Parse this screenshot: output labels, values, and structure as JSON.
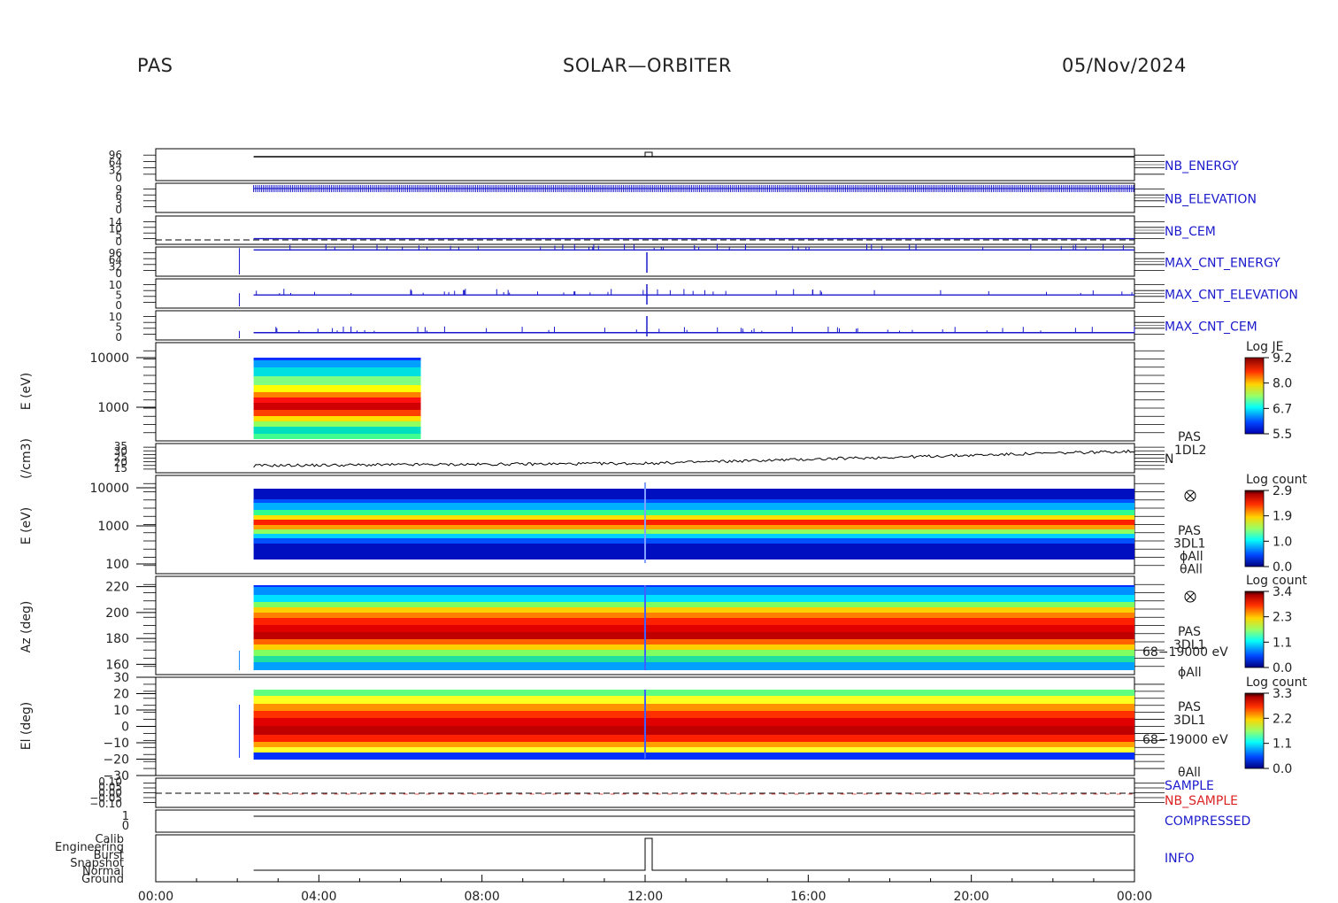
{
  "header": {
    "left": "PAS",
    "center": "SOLAR—ORBITER",
    "right": "05/Nov/2024"
  },
  "chart_data": {
    "type": "timeseries-stack",
    "x": {
      "range": [
        "00:00",
        "24:00"
      ],
      "ticks": [
        "00:00",
        "04:00",
        "08:00",
        "12:00",
        "16:00",
        "20:00",
        "00:00"
      ],
      "data_start_hour": 2.4,
      "spectro1_end_hour": 6.5
    },
    "panels": [
      {
        "id": "nb-energy",
        "label": "NB_ENERGY",
        "label_color": "#1a1acc",
        "yticks": [
          "96",
          "64",
          "32",
          "0"
        ],
        "line_level": 0.75
      },
      {
        "id": "nb-elevation",
        "label": "NB_ELEVATION",
        "label_color": "#1a1acc",
        "yticks": [
          "9",
          "6",
          "3",
          "0"
        ],
        "line_level": 0.82
      },
      {
        "id": "nb-cem",
        "label": "NB_CEM",
        "label_color": "#1a1acc",
        "yticks": [
          "14",
          "10",
          "5",
          "0"
        ],
        "line_level": 0.2
      },
      {
        "id": "max-cnt-energy",
        "label": "MAX_CNT_ENERGY",
        "label_color": "#1a1acc",
        "yticks": [
          "96",
          "64",
          "32",
          "0"
        ],
        "line_level": 0.9
      },
      {
        "id": "max-cnt-elevation",
        "label": "MAX_CNT_ELEVATION",
        "label_color": "#1a1acc",
        "yticks": [
          "10",
          "5",
          "0"
        ],
        "line_level": 0.45
      },
      {
        "id": "max-cnt-cem",
        "label": "MAX_CNT_CEM",
        "label_color": "#1a1acc",
        "yticks": [
          "10",
          "5",
          "0"
        ],
        "line_level": 0.25
      }
    ],
    "spectrograms": [
      {
        "id": "energy-1dl2",
        "ylabel": "E (eV)",
        "scale": "log",
        "yticks": [
          "10000",
          "1000"
        ],
        "peak_eV": 850,
        "colorbar_title": "Log JE",
        "colorbar_ticks": [
          "9.2",
          "8.0",
          "6.7",
          "5.5"
        ]
      },
      {
        "id": "energy-3dl1",
        "ylabel": "E (eV)",
        "scale": "log",
        "yticks": [
          "10000",
          "1000",
          "100"
        ],
        "peak_eV": 800,
        "side_labels": [
          "PAS",
          "3DL1",
          "ϕAll",
          "θAll"
        ],
        "colorbar_title": "Log count",
        "colorbar_ticks": [
          "2.9",
          "1.9",
          "1.0",
          "0.0"
        ]
      },
      {
        "id": "azimuth",
        "ylabel": "Az (deg)",
        "range": [
          152,
          228
        ],
        "yticks": [
          "220",
          "200",
          "180",
          "160"
        ],
        "side_labels": [
          "PAS",
          "3DL1",
          "68−19000 eV",
          "ϕAll"
        ],
        "colorbar_title": "Log count",
        "colorbar_ticks": [
          "3.4",
          "2.3",
          "1.1",
          "0.0"
        ]
      },
      {
        "id": "elevation",
        "ylabel": "El (deg)",
        "range": [
          -30,
          30
        ],
        "yticks": [
          "30",
          "20",
          "10",
          "0",
          "−10",
          "−20",
          "−30"
        ],
        "side_labels": [
          "PAS",
          "3DL1",
          "68−19000 eV",
          "θAll"
        ],
        "colorbar_title": "Log count",
        "colorbar_ticks": [
          "3.3",
          "2.2",
          "1.1",
          "0.0"
        ]
      }
    ],
    "density": {
      "ylabel": "(/cm3)",
      "yticks": [
        "35",
        "30",
        "25",
        "20",
        "15"
      ],
      "side_labels": [
        "PAS",
        "1DL2",
        "N"
      ],
      "trend": [
        17,
        19,
        30
      ]
    },
    "sample_panel": {
      "yticks": [
        "0.10",
        "0.05",
        "0.00",
        "−0.05",
        "−0.10"
      ],
      "labels": [
        {
          "text": "SAMPLE",
          "color": "#1a1acc"
        },
        {
          "text": "NB_SAMPLE",
          "color": "#dd2222"
        }
      ]
    },
    "compressed_panel": {
      "yticks": [
        "1",
        "0"
      ],
      "label": "COMPRESSED",
      "label_color": "#1a1acc"
    },
    "info_panel": {
      "yticks": [
        "Calib",
        "Engineering",
        "Burst",
        "Snapshot",
        "Normal",
        "Ground"
      ],
      "label": "INFO",
      "mode_before_12": "Normal",
      "mode_after_12": "Calib"
    }
  }
}
